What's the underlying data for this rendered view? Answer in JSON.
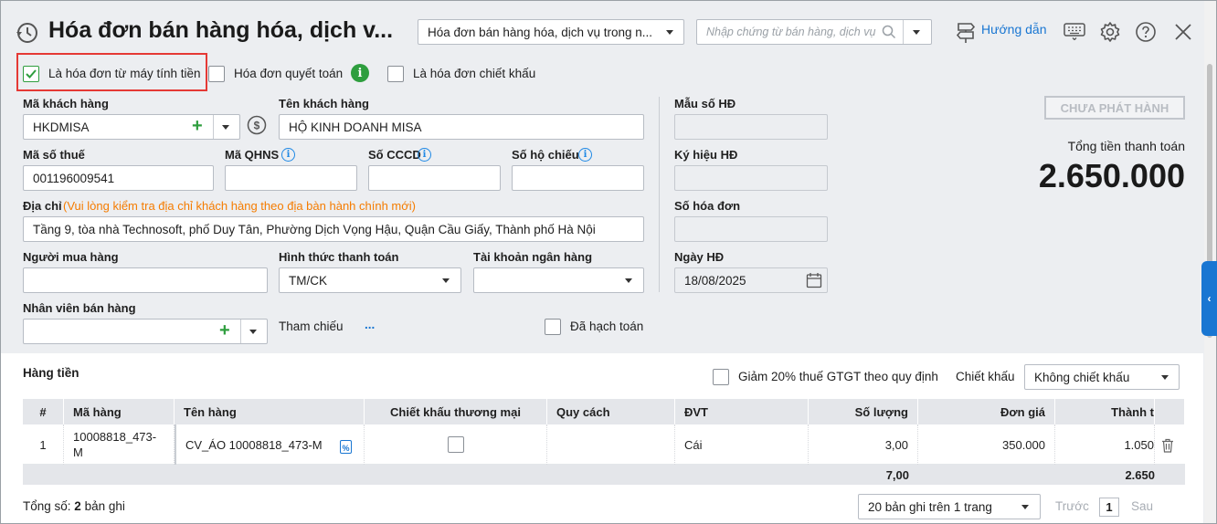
{
  "header": {
    "title": "Hóa đơn bán hàng hóa, dịch v...",
    "invoice_type_selected": "Hóa đơn bán hàng hóa, dịch vụ trong n...",
    "search_placeholder": "Nhập chứng từ bán hàng, dịch vụ",
    "help_label": "Hướng dẫn"
  },
  "options": {
    "from_cash_register_label": "Là hóa đơn từ máy tính tiền",
    "from_cash_register_checked": true,
    "settlement_label": "Hóa đơn quyết toán",
    "discount_invoice_label": "Là hóa đơn chiết khấu"
  },
  "customer": {
    "code_label": "Mã khách hàng",
    "code_value": "HKDMISA",
    "name_label": "Tên khách hàng",
    "name_value": "HỘ KINH DOANH MISA",
    "tax_code_label": "Mã số thuế",
    "tax_code_value": "001196009541",
    "qhns_label": "Mã QHNS",
    "cccd_label": "Số CCCD",
    "passport_label": "Số hộ chiếu",
    "address_label": "Địa chỉ",
    "address_note": "(Vui lòng kiểm tra địa chỉ khách hàng theo địa bàn hành chính mới)",
    "address_value": "Tầng 9, tòa nhà Technosoft, phố Duy Tân, Phường Dịch Vọng Hậu, Quận Cầu Giấy, Thành phố Hà Nội",
    "buyer_label": "Người mua hàng",
    "payment_method_label": "Hình thức thanh toán",
    "payment_method_value": "TM/CK",
    "bank_account_label": "Tài khoản ngân hàng",
    "sales_staff_label": "Nhân viên bán hàng",
    "reference_label": "Tham chiếu",
    "reference_link": "...",
    "posted_label": "Đã hạch toán"
  },
  "invoice_info": {
    "template_label": "Mẫu số HĐ",
    "symbol_label": "Ký hiệu HĐ",
    "number_label": "Số hóa đơn",
    "date_label": "Ngày HĐ",
    "date_value": "18/08/2025",
    "status_button": "CHƯA PHÁT HÀNH",
    "total_label": "Tổng tiền thanh toán",
    "total_value": "2.650.000"
  },
  "goods": {
    "section_title": "Hàng tiền",
    "vat_reduction_label": "Giảm 20% thuế GTGT theo quy định",
    "discount_label": "Chiết khấu",
    "discount_value": "Không chiết khấu",
    "columns": [
      "#",
      "Mã hàng",
      "Tên hàng",
      "Chiết khấu thương mại",
      "Quy cách",
      "ĐVT",
      "Số lượng",
      "Đơn giá",
      "Thành t"
    ],
    "rows": [
      {
        "no": "1",
        "code": "10008818_473-M",
        "name": "CV_ÁO 10008818_473-M",
        "spec": "",
        "unit": "Cái",
        "qty": "3,00",
        "price": "350.000",
        "amount": "1.050"
      }
    ],
    "footer_qty": "7,00",
    "footer_amount": "2.650"
  },
  "pager": {
    "total_prefix": "Tổng số:",
    "total_count": "2",
    "total_suffix": "bản ghi",
    "page_size": "20 bản ghi trên 1 trang",
    "prev": "Trước",
    "page": "1",
    "next": "Sau"
  },
  "colors": {
    "accent": "#1976d2",
    "highlight_border": "#e53935",
    "note_orange": "#f57c00",
    "plus_green": "#2e9e3e"
  }
}
